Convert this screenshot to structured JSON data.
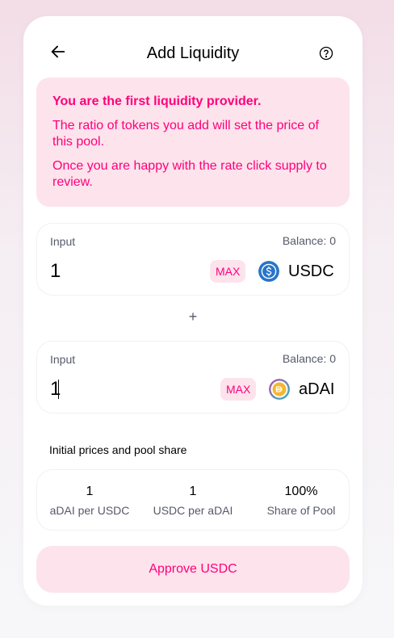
{
  "header": {
    "title": "Add Liquidity",
    "back_icon": "arrow-left-icon",
    "help_icon": "question-circle-icon"
  },
  "notice": {
    "heading": "You are the first liquidity provider.",
    "line1": "The ratio of tokens you add will set the price of this pool.",
    "line2": "Once you are happy with the rate click supply to review."
  },
  "input_a": {
    "label": "Input",
    "balance": "Balance: 0",
    "value": "1",
    "max_label": "MAX",
    "token": "USDC",
    "token_icon": "usdc-icon"
  },
  "separator": "+",
  "input_b": {
    "label": "Input",
    "balance": "Balance: 0",
    "value": "1",
    "max_label": "MAX",
    "token": "aDAI",
    "token_icon": "adai-icon"
  },
  "prices": {
    "title": "Initial prices and pool share",
    "items": [
      {
        "value": "1",
        "label": "aDAI per USDC"
      },
      {
        "value": "1",
        "label": "USDC per aDAI"
      },
      {
        "value": "100%",
        "label": "Share of Pool"
      }
    ]
  },
  "approve_button": "Approve USDC",
  "colors": {
    "accent": "#ff007a",
    "accent_bg": "#fde3ec",
    "text_secondary": "#565a69"
  }
}
